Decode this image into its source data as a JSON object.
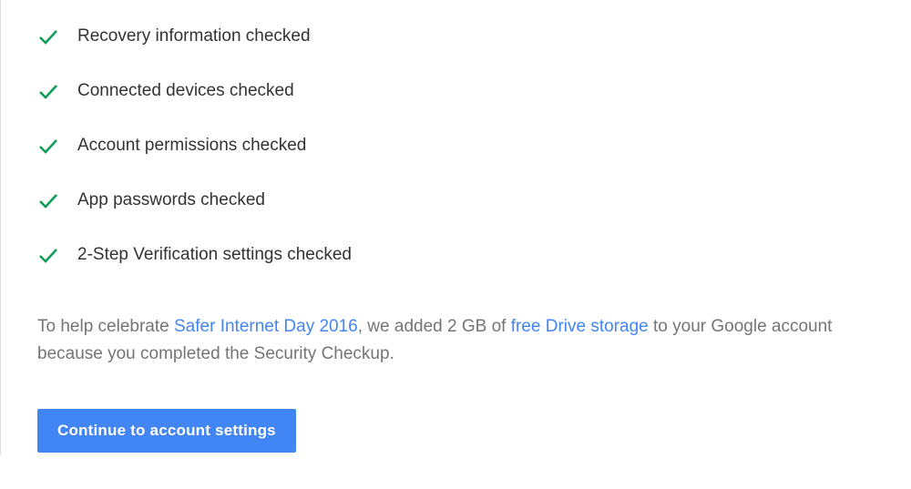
{
  "checks": {
    "items": [
      {
        "label": "Recovery information checked"
      },
      {
        "label": "Connected devices checked"
      },
      {
        "label": "Account permissions checked"
      },
      {
        "label": "App passwords checked"
      },
      {
        "label": "2-Step Verification settings checked"
      }
    ]
  },
  "message": {
    "part1": "To help celebrate ",
    "link1": "Safer Internet Day 2016",
    "part2": ", we added 2 GB of ",
    "link2": "free Drive storage",
    "part3": " to your Google account because you completed the Security Checkup."
  },
  "cta": {
    "label": "Continue to account settings"
  },
  "colors": {
    "check_green": "#0f9d58",
    "link_blue": "#4285f4",
    "button_blue": "#4285f4",
    "text_dark": "#333333",
    "text_muted": "#757575"
  }
}
